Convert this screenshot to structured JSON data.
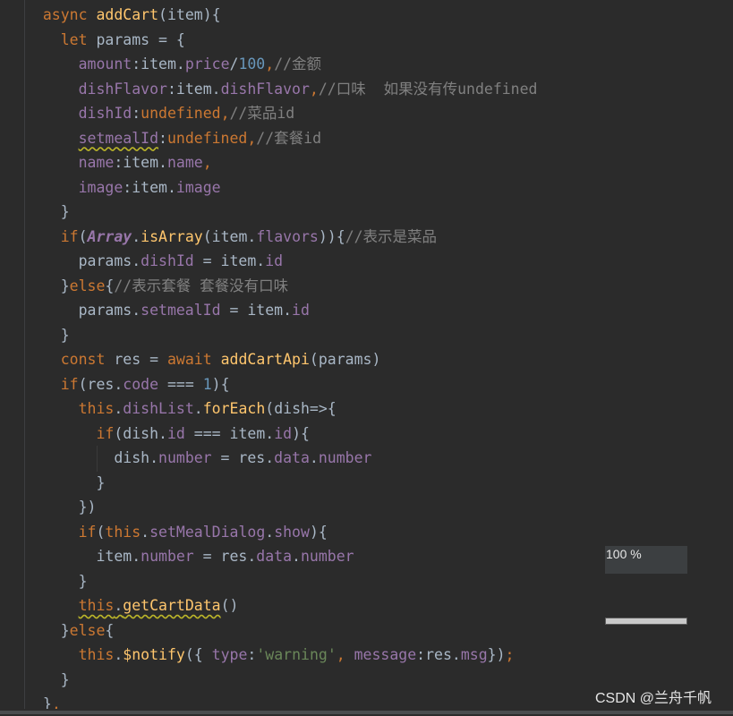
{
  "theme": {
    "background": "#2b2b2b",
    "default_text": "#a9b7c6",
    "keyword": "#cc7832",
    "function": "#ffc66d",
    "property": "#9876aa",
    "number": "#6897bb",
    "comment": "#808080",
    "string": "#6a8759"
  },
  "editor": {
    "lines": [
      [
        [
          "  ",
          "txt"
        ],
        [
          "async",
          "kw"
        ],
        [
          " ",
          "txt"
        ],
        [
          "addCart",
          "fn"
        ],
        [
          "(item){",
          "txt"
        ]
      ],
      [
        [
          "    ",
          "txt"
        ],
        [
          "let",
          "kw"
        ],
        [
          " params = {",
          "txt"
        ]
      ],
      [
        [
          "      ",
          "txt"
        ],
        [
          "amount",
          "prop"
        ],
        [
          ":item.",
          "txt"
        ],
        [
          "price",
          "prop"
        ],
        [
          "/",
          "txt"
        ],
        [
          "100",
          "num"
        ],
        [
          ",",
          "kw"
        ],
        [
          "//金额",
          "cmt"
        ]
      ],
      [
        [
          "      ",
          "txt"
        ],
        [
          "dishFlavor",
          "prop"
        ],
        [
          ":item.",
          "txt"
        ],
        [
          "dishFlavor",
          "prop"
        ],
        [
          ",",
          "kw"
        ],
        [
          "//口味  如果没有传undefined",
          "cmt"
        ]
      ],
      [
        [
          "      ",
          "txt"
        ],
        [
          "dishId",
          "prop"
        ],
        [
          ":",
          "txt"
        ],
        [
          "undefined",
          "kw"
        ],
        [
          ",",
          "kw"
        ],
        [
          "//菜品id",
          "cmt"
        ]
      ],
      [
        [
          "      ",
          "txt"
        ],
        [
          "setmealId",
          "prop",
          true
        ],
        [
          ":",
          "txt"
        ],
        [
          "undefined",
          "kw"
        ],
        [
          ",",
          "kw"
        ],
        [
          "//套餐id",
          "cmt"
        ]
      ],
      [
        [
          "      ",
          "txt"
        ],
        [
          "name",
          "prop"
        ],
        [
          ":item.",
          "txt"
        ],
        [
          "name",
          "prop"
        ],
        [
          ",",
          "kw"
        ]
      ],
      [
        [
          "      ",
          "txt"
        ],
        [
          "image",
          "prop"
        ],
        [
          ":item.",
          "txt"
        ],
        [
          "image",
          "prop"
        ]
      ],
      [
        [
          "    }",
          "txt"
        ]
      ],
      [
        [
          "    ",
          "txt"
        ],
        [
          "if",
          "kw"
        ],
        [
          "(",
          "txt"
        ],
        [
          "Array",
          "glob"
        ],
        [
          ".",
          "txt"
        ],
        [
          "isArray",
          "fn"
        ],
        [
          "(item.",
          "txt"
        ],
        [
          "flavors",
          "prop"
        ],
        [
          ")){",
          "txt"
        ],
        [
          "//表示是菜品",
          "cmt"
        ]
      ],
      [
        [
          "      params.",
          "txt"
        ],
        [
          "dishId",
          "prop"
        ],
        [
          " = item.",
          "txt"
        ],
        [
          "id",
          "prop"
        ]
      ],
      [
        [
          "    }",
          "txt"
        ],
        [
          "else",
          "kw"
        ],
        [
          "{",
          "txt"
        ],
        [
          "//表示套餐 套餐没有口味",
          "cmt"
        ]
      ],
      [
        [
          "      params.",
          "txt"
        ],
        [
          "setmealId",
          "prop"
        ],
        [
          " = item.",
          "txt"
        ],
        [
          "id",
          "prop"
        ]
      ],
      [
        [
          "    }",
          "txt"
        ]
      ],
      [
        [
          "    ",
          "txt"
        ],
        [
          "const",
          "kw"
        ],
        [
          " res = ",
          "txt"
        ],
        [
          "await",
          "kw"
        ],
        [
          " ",
          "txt"
        ],
        [
          "addCartApi",
          "fn"
        ],
        [
          "(params)",
          "txt"
        ]
      ],
      [
        [
          "    ",
          "txt"
        ],
        [
          "if",
          "kw"
        ],
        [
          "(res.",
          "txt"
        ],
        [
          "code",
          "prop"
        ],
        [
          " === ",
          "txt"
        ],
        [
          "1",
          "num"
        ],
        [
          "){",
          "txt"
        ]
      ],
      [
        [
          "      ",
          "txt"
        ],
        [
          "this",
          "kw"
        ],
        [
          ".",
          "txt"
        ],
        [
          "dishList",
          "prop"
        ],
        [
          ".",
          "txt"
        ],
        [
          "forEach",
          "fn"
        ],
        [
          "(dish=>{",
          "txt"
        ]
      ],
      [
        [
          "        ",
          "txt"
        ],
        [
          "if",
          "kw"
        ],
        [
          "(dish.",
          "txt"
        ],
        [
          "id",
          "prop"
        ],
        [
          " === item.",
          "txt"
        ],
        [
          "id",
          "prop"
        ],
        [
          "){",
          "txt"
        ]
      ],
      [
        [
          "          dish.",
          "txt"
        ],
        [
          "number",
          "prop"
        ],
        [
          " = res.",
          "txt"
        ],
        [
          "data",
          "prop"
        ],
        [
          ".",
          "txt"
        ],
        [
          "number",
          "prop"
        ]
      ],
      [
        [
          "        }",
          "txt"
        ]
      ],
      [
        [
          "      })",
          "txt"
        ]
      ],
      [
        [
          "      ",
          "txt"
        ],
        [
          "if",
          "kw"
        ],
        [
          "(",
          "txt"
        ],
        [
          "this",
          "kw"
        ],
        [
          ".",
          "txt"
        ],
        [
          "setMealDialog",
          "prop"
        ],
        [
          ".",
          "txt"
        ],
        [
          "show",
          "prop"
        ],
        [
          "){",
          "txt"
        ]
      ],
      [
        [
          "        item.",
          "txt"
        ],
        [
          "number",
          "prop"
        ],
        [
          " = res.",
          "txt"
        ],
        [
          "data",
          "prop"
        ],
        [
          ".",
          "txt"
        ],
        [
          "number",
          "prop"
        ]
      ],
      [
        [
          "      }",
          "txt"
        ]
      ],
      [
        [
          "      ",
          "txt"
        ],
        [
          "this",
          "kw",
          true
        ],
        [
          ".",
          "txt",
          true
        ],
        [
          "getCartData",
          "fn",
          true
        ],
        [
          "()",
          "txt"
        ]
      ],
      [
        [
          "    }",
          "txt"
        ],
        [
          "else",
          "kw"
        ],
        [
          "{",
          "txt"
        ]
      ],
      [
        [
          "      ",
          "txt"
        ],
        [
          "this",
          "kw"
        ],
        [
          ".",
          "txt"
        ],
        [
          "$notify",
          "fn"
        ],
        [
          "({ ",
          "txt"
        ],
        [
          "type",
          "prop"
        ],
        [
          ":",
          "txt"
        ],
        [
          "'warning'",
          "str"
        ],
        [
          ", ",
          "kw"
        ],
        [
          "message",
          "prop"
        ],
        [
          ":res.",
          "txt"
        ],
        [
          "msg",
          "prop"
        ],
        [
          "})",
          "txt"
        ],
        [
          ";",
          "kw"
        ]
      ],
      [
        [
          "    }",
          "txt"
        ]
      ],
      [
        [
          "  }",
          "txt"
        ],
        [
          ",",
          "kw"
        ]
      ]
    ]
  },
  "zoom": {
    "label": "100 %",
    "bar_level_percent": 100
  },
  "watermark": "CSDN @兰舟千帆"
}
